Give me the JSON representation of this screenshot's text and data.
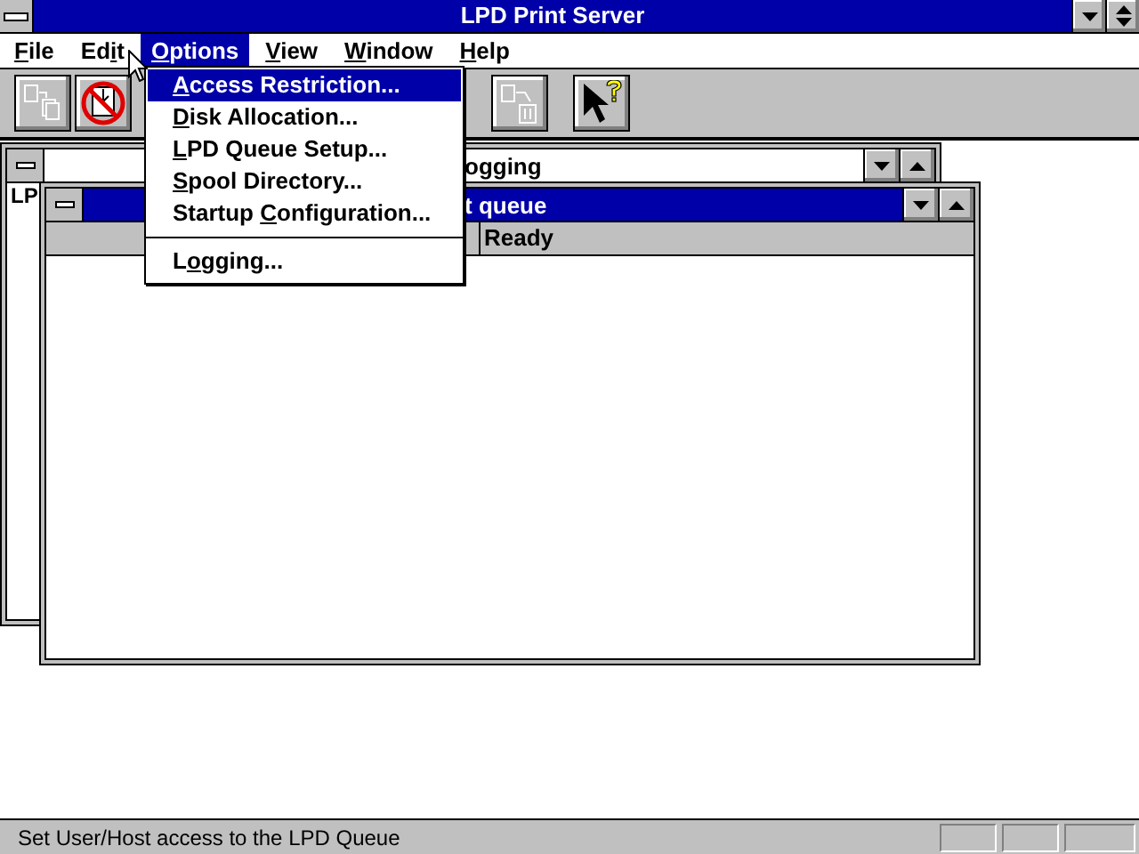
{
  "window": {
    "title": "LPD Print Server"
  },
  "menu_bar": [
    {
      "key": "F",
      "post": "ile",
      "selected": false
    },
    {
      "pre": "Ed",
      "key": "i",
      "post": "t",
      "selected": false
    },
    {
      "key": "O",
      "post": "ptions",
      "selected": true
    },
    {
      "key": "V",
      "post": "iew",
      "selected": false
    },
    {
      "key": "W",
      "post": "indow",
      "selected": false
    },
    {
      "key": "H",
      "post": "elp",
      "selected": false
    }
  ],
  "dropdown": {
    "items": [
      {
        "kind": "item",
        "key": "A",
        "post": "ccess Restriction...",
        "selected": true
      },
      {
        "kind": "item",
        "key": "D",
        "post": "isk Allocation...",
        "selected": false
      },
      {
        "kind": "item",
        "key": "L",
        "post": "PD Queue Setup...",
        "selected": false
      },
      {
        "kind": "item",
        "key": "S",
        "post": "pool Directory...",
        "selected": false
      },
      {
        "kind": "item",
        "pre": "Startup ",
        "key": "C",
        "post": "onfiguration...",
        "selected": false
      },
      {
        "kind": "separator"
      },
      {
        "kind": "item",
        "pre": "L",
        "key": "o",
        "post": "gging...",
        "selected": false
      }
    ]
  },
  "toolbar": [
    {
      "kind": "copy",
      "disabled": true
    },
    {
      "kind": "no-print",
      "disabled": false
    },
    {
      "kind": "delete",
      "disabled": true
    },
    {
      "kind": "help",
      "disabled": false
    }
  ],
  "child_windows": [
    {
      "title": "ogging",
      "active": false,
      "cell": "LP"
    },
    {
      "title": "t queue",
      "active": true,
      "columns": [
        "Ready"
      ]
    }
  ],
  "status_bar": {
    "text": "Set User/Host access to the LPD Queue"
  }
}
